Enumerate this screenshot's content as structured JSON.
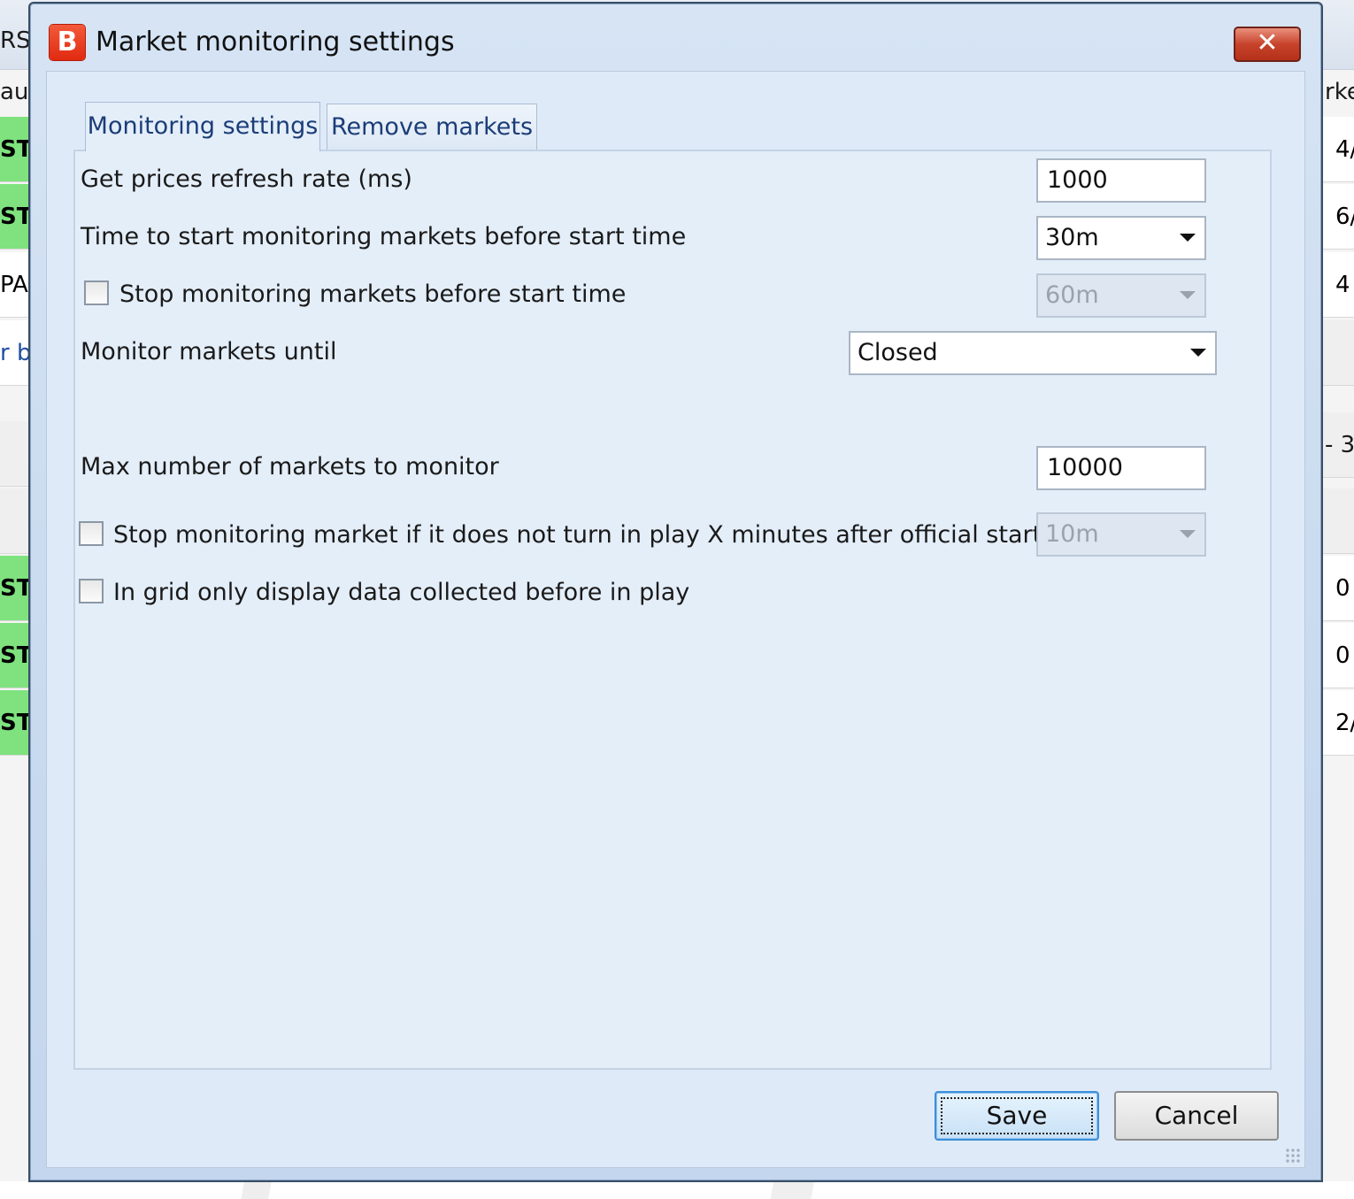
{
  "background_app": {
    "left_column": [
      "RS",
      "aus",
      "ST",
      "ST",
      "PA",
      "r b",
      "",
      "",
      "ST",
      "ST",
      "ST"
    ],
    "right_column": [
      "",
      "rke",
      "4/",
      "6/",
      "4",
      "",
      "- 3",
      "",
      "0",
      "0",
      "2/"
    ]
  },
  "dialog": {
    "title": "Market monitoring settings",
    "app_icon_glyph": "B",
    "close_glyph": "✕"
  },
  "tabs": [
    {
      "label": "Monitoring settings",
      "active": true
    },
    {
      "label": "Remove markets",
      "active": false
    }
  ],
  "settings": {
    "refresh_rate": {
      "label": "Get prices refresh rate (ms)",
      "value": "1000"
    },
    "start_monitoring": {
      "label": "Time to start monitoring markets before start time",
      "value": "30m"
    },
    "stop_before_start": {
      "label": "Stop monitoring markets before start time",
      "checked": false,
      "value": "60m",
      "enabled": false
    },
    "monitor_until": {
      "label": "Monitor markets until",
      "value": "Closed"
    },
    "max_markets": {
      "label": "Max number of markets to monitor",
      "value": "10000"
    },
    "stop_not_inplay": {
      "label": "Stop monitoring market if it does not turn in play X minutes after official start time",
      "checked": false,
      "value": "10m",
      "enabled": false
    },
    "grid_before_inplay": {
      "label": "In grid only display data collected before in play",
      "checked": false
    }
  },
  "buttons": {
    "save": "Save",
    "cancel": "Cancel"
  },
  "colors": {
    "title_bar": "#c9daef",
    "client_bg": "#dfeaf8",
    "close_button": "#c8432b",
    "save_focus": "#3c8fd8",
    "grid_green": "#7fe27f"
  }
}
